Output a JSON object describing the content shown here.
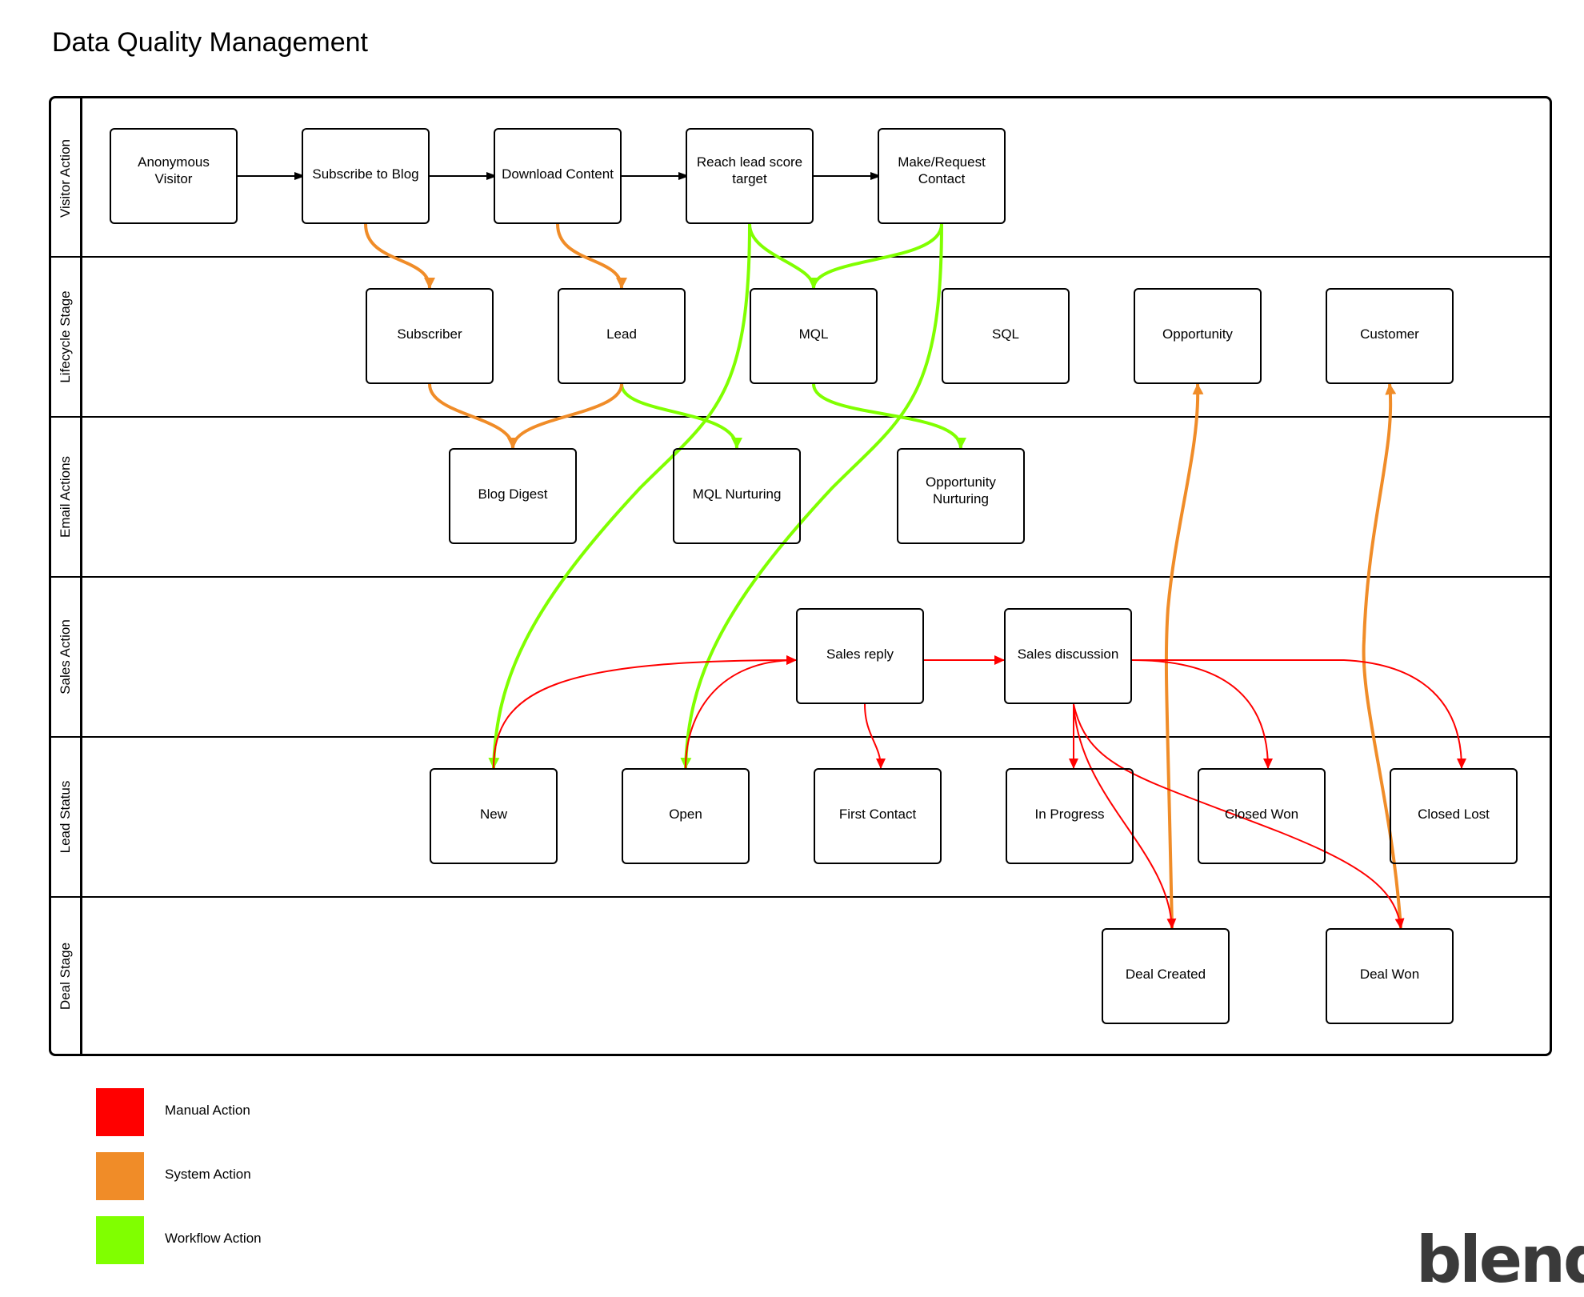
{
  "title": "Data Quality Management",
  "colors": {
    "manual": "#FF0000",
    "system": "#F08C28",
    "workflow": "#80FF00",
    "stroke": "#000000",
    "brand": "#3A3A3A"
  },
  "lanes": [
    {
      "id": "visitor",
      "label": "Visitor Action"
    },
    {
      "id": "lifecycle",
      "label": "Lifecycle Stage"
    },
    {
      "id": "email",
      "label": "Email Actions"
    },
    {
      "id": "sales",
      "label": "Sales Action"
    },
    {
      "id": "leadstatus",
      "label": "Lead Status"
    },
    {
      "id": "deal",
      "label": "Deal Stage"
    }
  ],
  "nodes": {
    "anon": "Anonymous\nVisitor",
    "subscribe": "Subscribe to Blog",
    "download": "Download Content",
    "reach": "Reach lead score\ntarget",
    "make": "Make/Request\nContact",
    "subscriber": "Subscriber",
    "lead": "Lead",
    "mql": "MQL",
    "sql": "SQL",
    "opportunity": "Opportunity",
    "customer": "Customer",
    "blogdigest": "Blog Digest",
    "mqlnurt": "MQL Nurturing",
    "oppnurt": "Opportunity\nNurturing",
    "salesreply": "Sales reply",
    "salesdisc": "Sales discussion",
    "new": "New",
    "open": "Open",
    "firstcontact": "First Contact",
    "inprogress": "In Progress",
    "closedwon": "Closed Won",
    "closedlost": "Closed Lost",
    "dealcreated": "Deal Created",
    "dealwon": "Deal Won"
  },
  "edges": [
    {
      "from": "anon",
      "to": "subscribe",
      "type": "flow"
    },
    {
      "from": "subscribe",
      "to": "download",
      "type": "flow"
    },
    {
      "from": "download",
      "to": "reach",
      "type": "flow"
    },
    {
      "from": "reach",
      "to": "make",
      "type": "flow"
    },
    {
      "from": "subscribe",
      "to": "subscriber",
      "type": "system"
    },
    {
      "from": "download",
      "to": "lead",
      "type": "system"
    },
    {
      "from": "subscriber",
      "to": "blogdigest",
      "type": "system"
    },
    {
      "from": "lead",
      "to": "blogdigest",
      "type": "system"
    },
    {
      "from": "dealcreated",
      "to": "opportunity",
      "type": "system"
    },
    {
      "from": "dealwon",
      "to": "customer",
      "type": "system"
    },
    {
      "from": "reach",
      "to": "mql",
      "type": "workflow"
    },
    {
      "from": "make",
      "to": "mql",
      "type": "workflow"
    },
    {
      "from": "reach",
      "to": "new",
      "type": "workflow"
    },
    {
      "from": "make",
      "to": "open",
      "type": "workflow"
    },
    {
      "from": "lead",
      "to": "mqlnurt",
      "type": "workflow"
    },
    {
      "from": "mql",
      "to": "oppnurt",
      "type": "workflow"
    },
    {
      "from": "new",
      "to": "salesreply",
      "type": "manual"
    },
    {
      "from": "open",
      "to": "salesreply",
      "type": "manual"
    },
    {
      "from": "salesreply",
      "to": "salesdisc",
      "type": "manual"
    },
    {
      "from": "salesreply",
      "to": "firstcontact",
      "type": "manual"
    },
    {
      "from": "salesdisc",
      "to": "inprogress",
      "type": "manual"
    },
    {
      "from": "salesdisc",
      "to": "closedwon",
      "type": "manual"
    },
    {
      "from": "salesdisc",
      "to": "closedlost",
      "type": "manual"
    },
    {
      "from": "salesdisc",
      "to": "dealcreated",
      "type": "manual"
    },
    {
      "from": "salesdisc",
      "to": "dealwon",
      "type": "manual"
    }
  ],
  "legend": [
    {
      "key": "manual",
      "label": "Manual Action"
    },
    {
      "key": "system",
      "label": "System Action"
    },
    {
      "key": "workflow",
      "label": "Workflow Action"
    }
  ],
  "brand": {
    "name": "blend",
    "mark": "®"
  }
}
